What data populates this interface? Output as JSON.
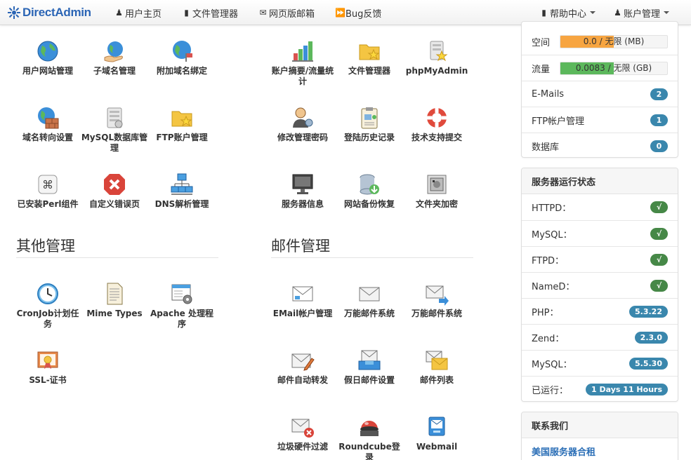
{
  "brand": {
    "name": "DirectAdmin"
  },
  "nav": {
    "home": "用户主页",
    "files": "文件管理器",
    "webmail": "网页版邮箱",
    "bug": "Bug反馈",
    "help": "帮助中心",
    "account": "账户管理"
  },
  "grid": {
    "domain": [
      {
        "label": "用户网站管理",
        "icon": "globe-icon"
      },
      {
        "label": "子域名管理",
        "icon": "globe-hand-icon"
      },
      {
        "label": "附加域名绑定",
        "icon": "globe-flag-icon"
      },
      {
        "label": "域名转向设置",
        "icon": "globe-brick-icon"
      },
      {
        "label": "MySQL数据库管理",
        "icon": "database-server-icon"
      },
      {
        "label": "FTP账户管理",
        "icon": "folder-star-icon"
      },
      {
        "label": "已安装Perl组件",
        "icon": "command-key-icon"
      },
      {
        "label": "自定义错误页",
        "icon": "error-x-icon"
      },
      {
        "label": "DNS解析管理",
        "icon": "network-icon"
      }
    ],
    "account": [
      {
        "label": "账户摘要/流量统计",
        "icon": "bar-chart-icon"
      },
      {
        "label": "文件管理器",
        "icon": "folder-star-icon"
      },
      {
        "label": "phpMyAdmin",
        "icon": "server-star-icon"
      },
      {
        "label": "修改管理密码",
        "icon": "user-key-icon"
      },
      {
        "label": "登陆历史记录",
        "icon": "clipboard-icon"
      },
      {
        "label": "技术支持提交",
        "icon": "lifebuoy-icon"
      },
      {
        "label": "服务器信息",
        "icon": "monitor-icon"
      },
      {
        "label": "网站备份恢复",
        "icon": "database-download-icon"
      },
      {
        "label": "文件夹加密",
        "icon": "safe-icon"
      }
    ],
    "other": [
      {
        "label": "CronJob计划任务",
        "icon": "clock-icon"
      },
      {
        "label": "Mime Types",
        "icon": "document-icon"
      },
      {
        "label": "Apache 处理程序",
        "icon": "window-gear-icon"
      },
      {
        "label": "SSL-证书",
        "icon": "certificate-icon"
      }
    ],
    "mail": [
      {
        "label": "EMail帐户管理",
        "icon": "mail-card-icon"
      },
      {
        "label": "万能邮件系统",
        "icon": "envelope-icon"
      },
      {
        "label": "万能邮件系统",
        "icon": "envelope-arrow-icon"
      },
      {
        "label": "邮件自动转发",
        "icon": "envelope-pen-icon"
      },
      {
        "label": "假日邮件设置",
        "icon": "mail-tray-icon"
      },
      {
        "label": "邮件列表",
        "icon": "envelopes-icon"
      },
      {
        "label": "垃圾硬件过滤",
        "icon": "envelope-x-icon"
      },
      {
        "label": "Roundcube登录",
        "icon": "roundcube-icon"
      },
      {
        "label": "Webmail",
        "icon": "webmail-icon"
      }
    ]
  },
  "sections": {
    "other": "其他管理",
    "mail": "邮件管理"
  },
  "usage": {
    "space_label": "空间",
    "space_text": "0.0 / 无限 (MB)",
    "space_fill_fraction": 0.5,
    "traffic_label": "流量",
    "traffic_text": "0.0083 / 无限 (GB)",
    "traffic_fill_fraction": 0.5,
    "emails_label": "E-Mails",
    "emails_count": "2",
    "ftp_label": "FTP帐户管理",
    "ftp_count": "1",
    "db_label": "数据库",
    "db_count": "0"
  },
  "status": {
    "title": "服务器运行状态",
    "rows": [
      {
        "label": "HTTPD：",
        "value": "√"
      },
      {
        "label": "MySQL：",
        "value": "√"
      },
      {
        "label": "FTPD：",
        "value": "√"
      },
      {
        "label": "NameD：",
        "value": "√"
      },
      {
        "label": "PHP：",
        "value": "5.3.22"
      },
      {
        "label": "Zend：",
        "value": "2.3.0"
      },
      {
        "label": "MySQL：",
        "value": "5.5.30"
      },
      {
        "label": "已运行：",
        "value": "1 Days 11 Hours"
      }
    ]
  },
  "contact": {
    "title": "联系我们",
    "link": "美国服务器合租"
  },
  "colors": {
    "brand": "#2b65b5",
    "space_bar": "#f7a541",
    "traffic_bar": "#5cb85c",
    "badge_info": "#3a87ad",
    "badge_success": "#468847",
    "link": "#2a6eb6"
  }
}
